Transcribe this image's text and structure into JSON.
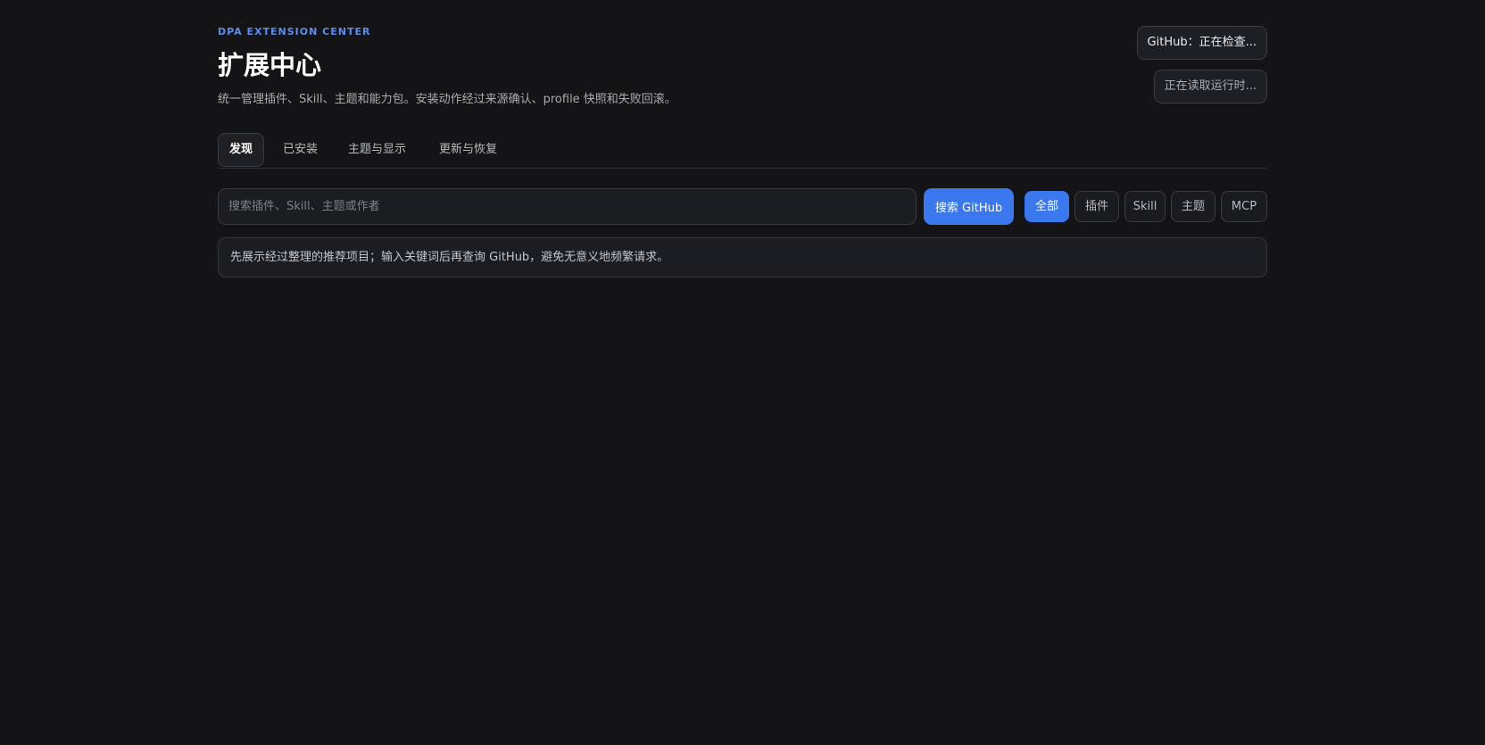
{
  "header": {
    "eyebrow": "DPA EXTENSION CENTER",
    "title": "扩展中心",
    "subtitle": "统一管理插件、Skill、主题和能力包。安装动作经过来源确认、profile 快照和失败回滚。"
  },
  "status": {
    "github": "GitHub：正在检查...",
    "runtime": "正在读取运行时..."
  },
  "tabs": [
    {
      "label": "发现",
      "active": true
    },
    {
      "label": "已安装",
      "active": false
    },
    {
      "label": "主题与显示",
      "active": false
    },
    {
      "label": "更新与恢复",
      "active": false
    }
  ],
  "search": {
    "placeholder": "搜索插件、Skill、主题或作者",
    "value": "",
    "button_label": "搜索 GitHub"
  },
  "filters": [
    {
      "label": "全部",
      "active": true
    },
    {
      "label": "插件",
      "active": false
    },
    {
      "label": "Skill",
      "active": false
    },
    {
      "label": "主题",
      "active": false
    },
    {
      "label": "MCP",
      "active": false
    }
  ],
  "notice": "先展示经过整理的推荐项目；输入关键词后再查询 GitHub，避免无意义地频繁请求。",
  "colors": {
    "background": "#141416",
    "accent": "#3b78f0",
    "eyebrow": "#5b8def"
  }
}
